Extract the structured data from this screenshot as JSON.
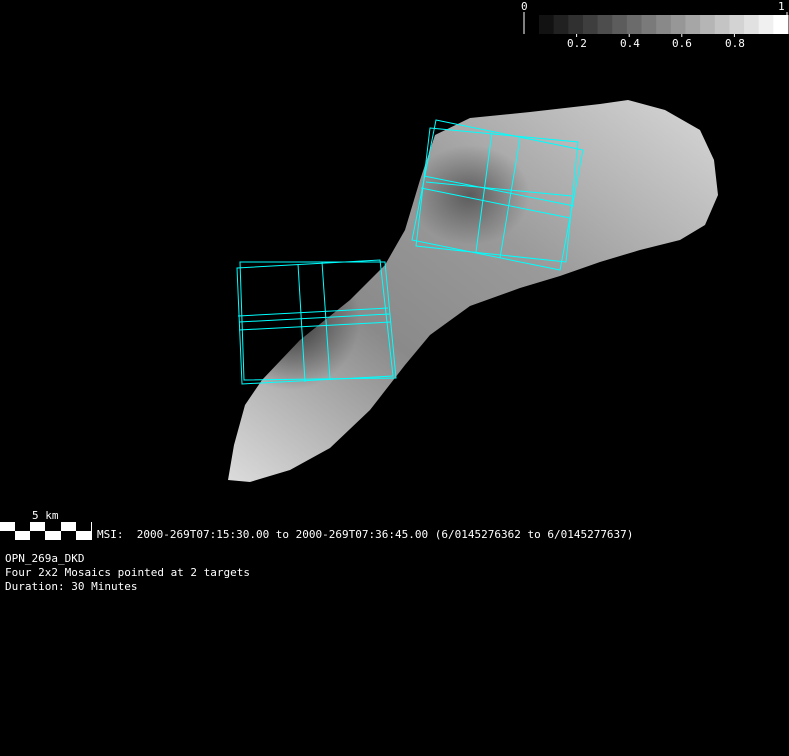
{
  "colorbar": {
    "min_label": "0",
    "max_label": "1",
    "tick_labels": [
      "0.2",
      "0.4",
      "0.6",
      "0.8"
    ],
    "steps": 17
  },
  "scale_bar": {
    "label": "5 km"
  },
  "observation": {
    "msi_line": "MSI:  2000-269T07:15:30.00 to 2000-269T07:36:45.00 (6/0145276362 to 6/0145277637)",
    "id": "OPN_269a_DKD",
    "description": "Four 2x2 Mosaics pointed at 2 targets",
    "duration": "Duration: 30 Minutes"
  },
  "colors": {
    "footprint": "#00ffff",
    "background": "#000000"
  }
}
